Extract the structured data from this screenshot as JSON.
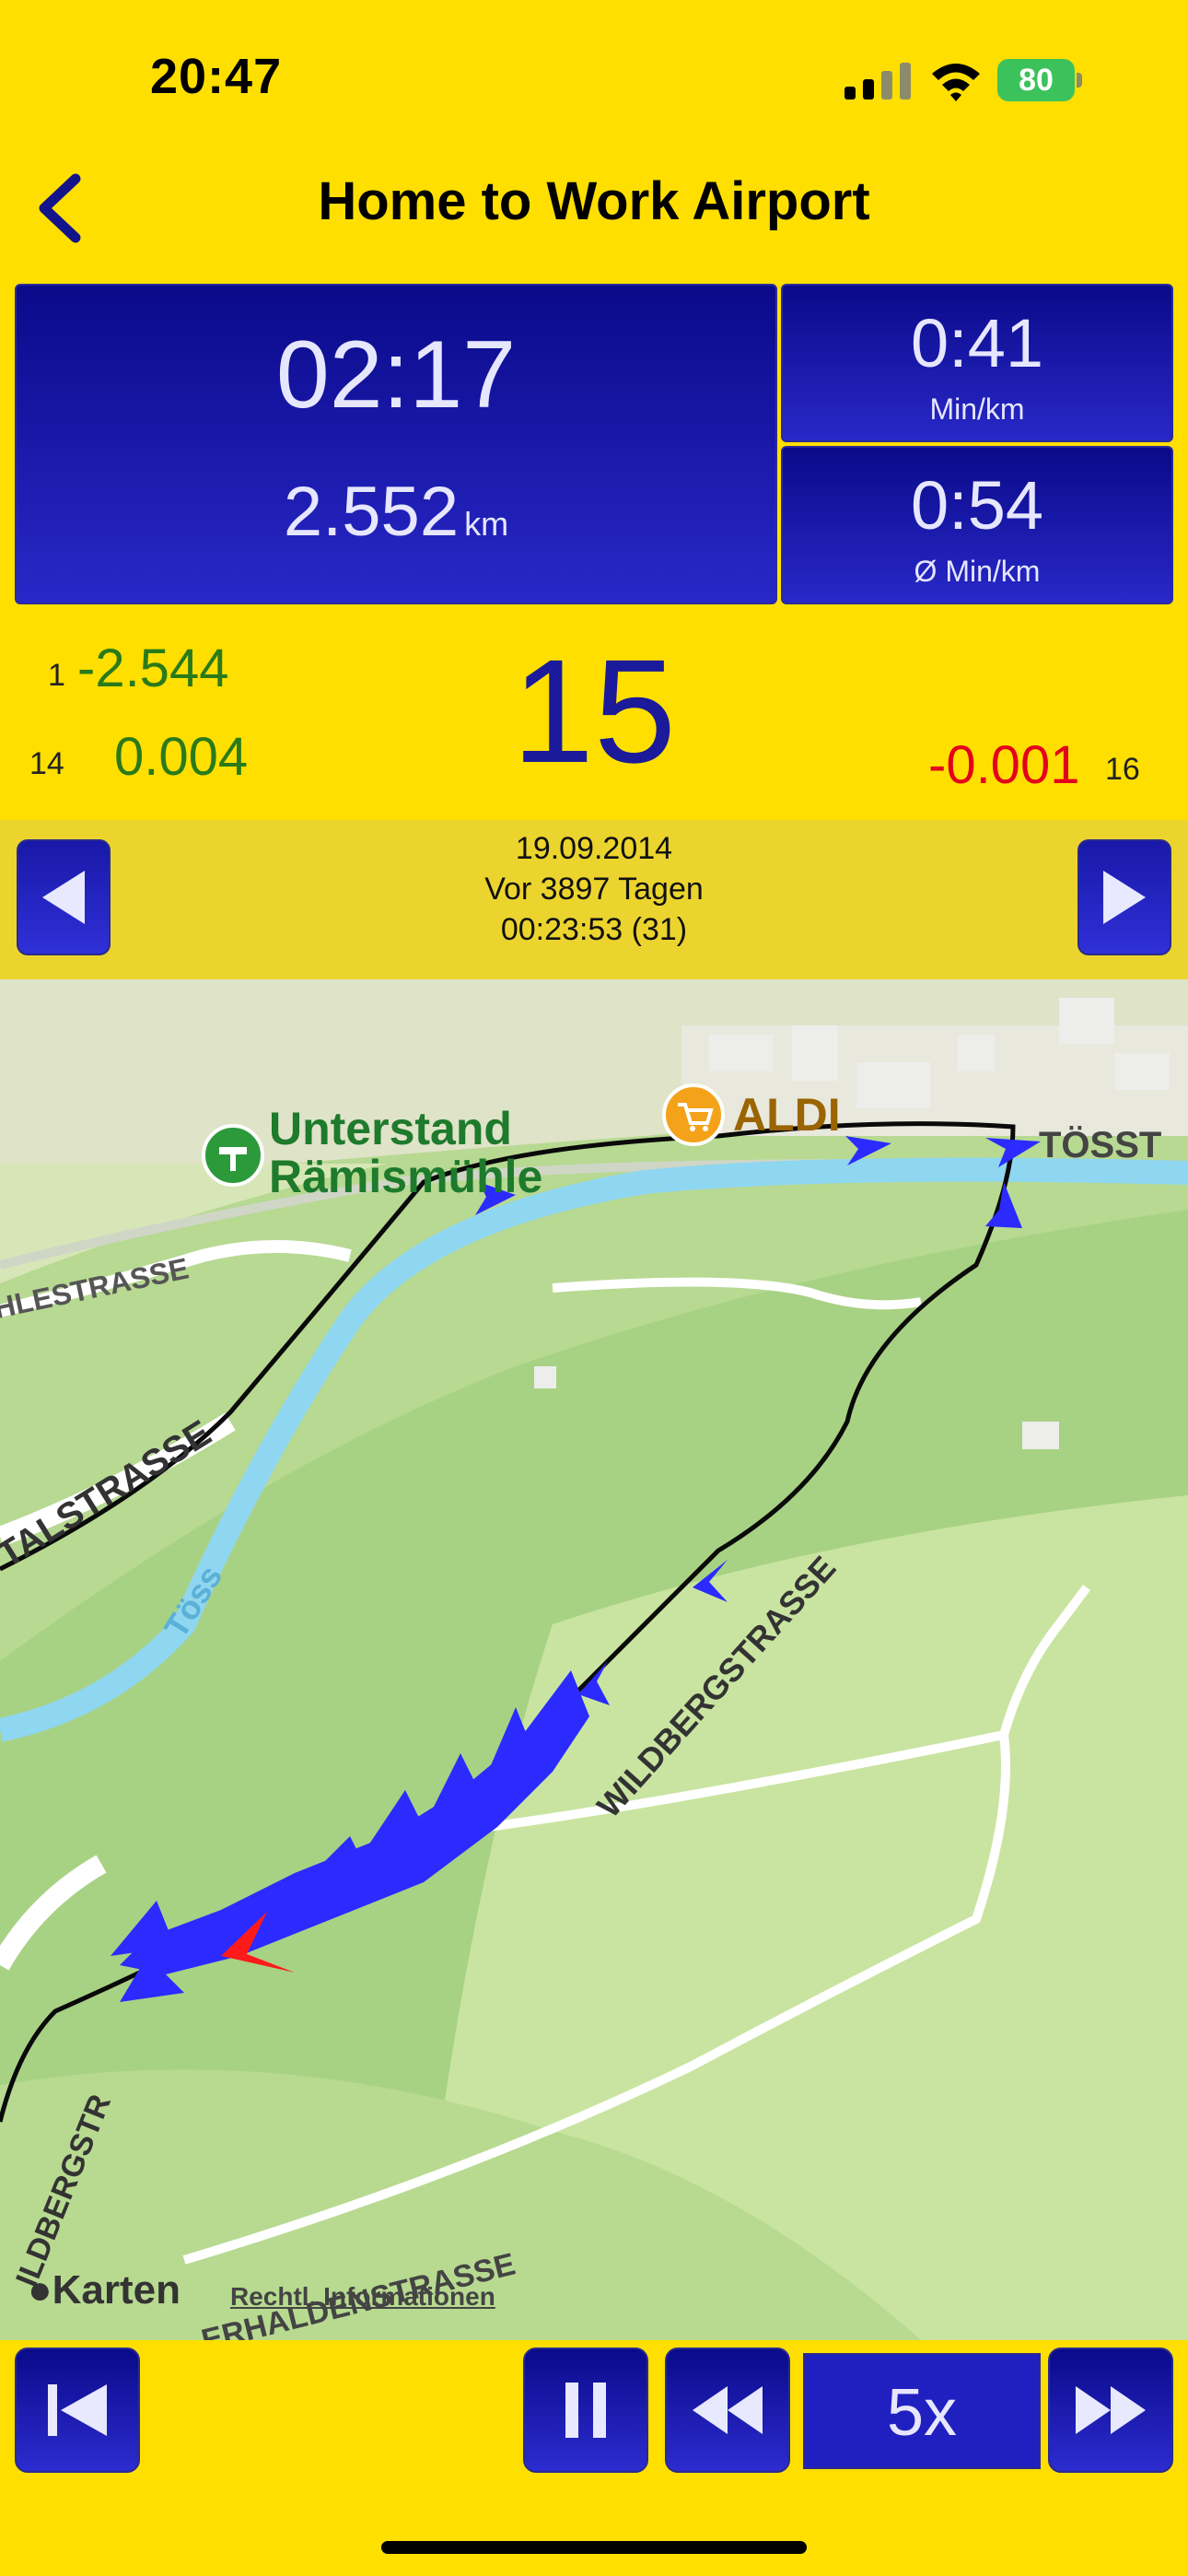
{
  "status_bar": {
    "time": "20:47",
    "battery": "80"
  },
  "nav": {
    "title": "Home to Work Airport"
  },
  "stats": {
    "elapsed": "02:17",
    "distance": "2.552",
    "distance_unit": "km",
    "current_pace": "0:41",
    "current_pace_unit": "Min/km",
    "avg_pace": "0:54",
    "avg_pace_unit": "Ø  Min/km"
  },
  "splits": {
    "prev_lap": "1",
    "prev_diff": "-2.544",
    "prev2_lap": "14",
    "prev2_diff": "0.004",
    "current_lap": "15",
    "next_diff": "-0.001",
    "next_lap": "16"
  },
  "session": {
    "date": "19.09.2014",
    "ago": "Vor 3897 Tagen",
    "time": "00:23:53 (31)"
  },
  "map": {
    "poi_1": "Unterstand",
    "poi_1b": "Rämismühle",
    "poi_2": "ALDI",
    "street_1": "HLESTRASSE",
    "street_2": "TALSTRASSE",
    "street_3": "TÖSST",
    "street_4": "WILDBERGSTRASSE",
    "street_5": "ILDBERGSTR",
    "street_6": "ERHALDENSTRASSE",
    "river": "Töss",
    "attribution": "Karten",
    "legal": "Rechtl. Informationen"
  },
  "controls": {
    "speed": "5x"
  },
  "colors": {
    "background": "#ffdf00",
    "panel": "#1a1aa8",
    "track": "#2b2bff",
    "green": "#2a7a1a",
    "red": "#e3001b"
  }
}
